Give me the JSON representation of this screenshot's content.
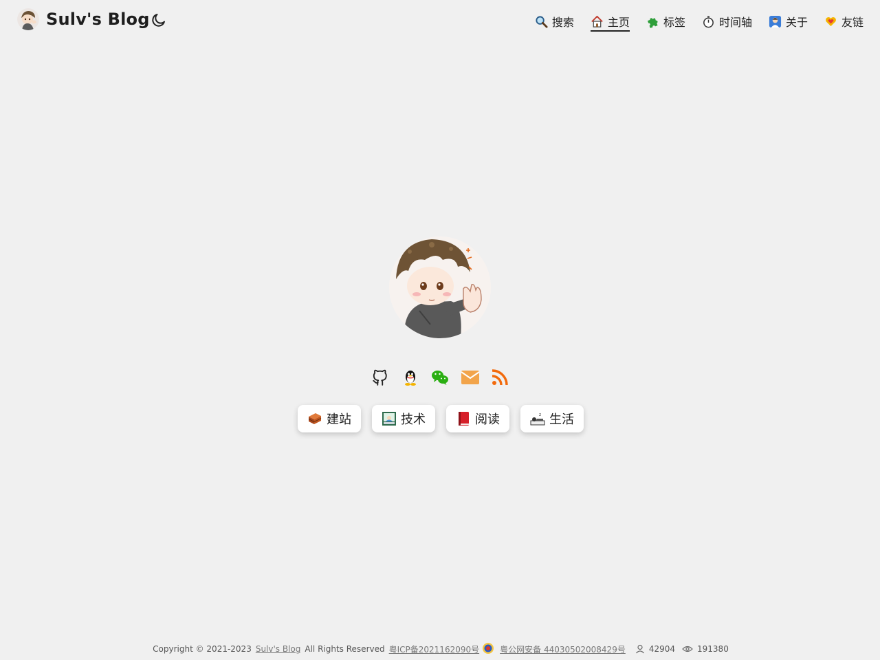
{
  "site": {
    "title": "Sulv's Blog"
  },
  "header": {
    "theme_toggle_icon": "moon-icon",
    "nav": [
      {
        "label": "搜索",
        "icon": "magnifier-icon",
        "active": false
      },
      {
        "label": "主页",
        "icon": "house-icon",
        "active": true
      },
      {
        "label": "标签",
        "icon": "puzzle-icon",
        "active": false
      },
      {
        "label": "时间轴",
        "icon": "stopwatch-icon",
        "active": false
      },
      {
        "label": "关于",
        "icon": "person-icon",
        "active": false
      },
      {
        "label": "友链",
        "icon": "heart-hands-icon",
        "active": false
      }
    ]
  },
  "profile": {
    "avatar_icon": "cartoon-boy-avatar-icon"
  },
  "socials": [
    {
      "icon": "github-icon"
    },
    {
      "icon": "qq-icon"
    },
    {
      "icon": "wechat-icon",
      "color": "#2aae12"
    },
    {
      "icon": "email-icon",
      "color": "#f2a44a"
    },
    {
      "icon": "rss-icon",
      "color": "#f26a0c"
    }
  ],
  "categories": [
    {
      "label": "建站",
      "icon": "bricks-icon"
    },
    {
      "label": "技术",
      "icon": "computer-icon"
    },
    {
      "label": "阅读",
      "icon": "red-book-icon"
    },
    {
      "label": "生活",
      "icon": "sleeping-person-icon"
    }
  ],
  "footer": {
    "copyright": "Copyright © 2021-2023",
    "site_link": "Sulv's Blog",
    "rights": "All Rights Reserved",
    "icp": "粤ICP备2021162090号",
    "police": "粤公网安备 44030502008429号",
    "visitors": "42904",
    "views": "191380"
  }
}
